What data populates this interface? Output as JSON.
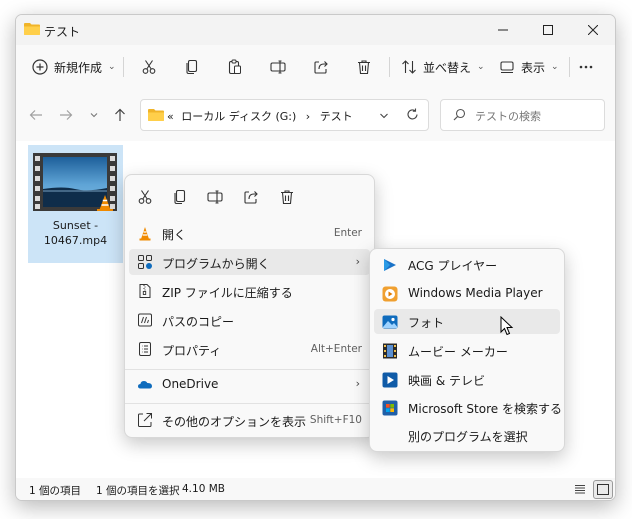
{
  "window": {
    "title": "テスト",
    "controls": [
      "minimize-icon",
      "maximize-icon",
      "close-icon"
    ]
  },
  "toolbar": {
    "new_label": "新規作成",
    "sort_label": "並べ替え",
    "view_label": "表示",
    "icons": [
      "cut-icon",
      "copy-icon",
      "paste-icon",
      "rename-icon",
      "share-icon",
      "delete-icon",
      "more-icon"
    ]
  },
  "address": {
    "prefix": "«",
    "drive": "ローカル ディスク (G:)",
    "separator": "›",
    "folder": "テスト",
    "search_placeholder": "テストの検索"
  },
  "file": {
    "name_line1": "Sunset -",
    "name_line2": "10467.mp4"
  },
  "context_menu": {
    "quick_icons": [
      "cut-icon",
      "copy-icon",
      "rename-icon",
      "share-icon",
      "delete-icon"
    ],
    "items": [
      {
        "label": "開く",
        "shortcut": "Enter",
        "icon": "vlc-icon"
      },
      {
        "label": "プログラムから開く",
        "shortcut": "",
        "icon": "open-with-icon"
      },
      {
        "label": "ZIP ファイルに圧縮する",
        "shortcut": "",
        "icon": "zip-icon"
      },
      {
        "label": "パスのコピー",
        "shortcut": "",
        "icon": "copy-path-icon"
      },
      {
        "label": "プロパティ",
        "shortcut": "Alt+Enter",
        "icon": "properties-icon"
      },
      {
        "label": "OneDrive",
        "shortcut": "",
        "icon": "onedrive-icon"
      },
      {
        "label": "その他のオプションを表示",
        "shortcut": "Shift+F10",
        "icon": "more-options-icon"
      }
    ]
  },
  "submenu": {
    "items": [
      {
        "label": "ACG プレイヤー",
        "icon": "acg-player-icon"
      },
      {
        "label": "Windows Media Player",
        "icon": "media-player-icon"
      },
      {
        "label": "フォト",
        "icon": "photos-icon"
      },
      {
        "label": "ムービー メーカー",
        "icon": "movie-maker-icon"
      },
      {
        "label": "映画 & テレビ",
        "icon": "movies-tv-icon"
      },
      {
        "label": "Microsoft Store を検索する",
        "icon": "store-icon"
      },
      {
        "label": "別のプログラムを選択",
        "icon": ""
      }
    ]
  },
  "status": {
    "count": "1 個の項目",
    "selected": "1 個の項目を選択",
    "size": "4.10 MB"
  },
  "colors": {
    "selection": "#cce4f7",
    "menu_bg": "#f9f9f9",
    "menu_hover": "#e9e9e9",
    "accent_blue": "#0f6cbd"
  }
}
